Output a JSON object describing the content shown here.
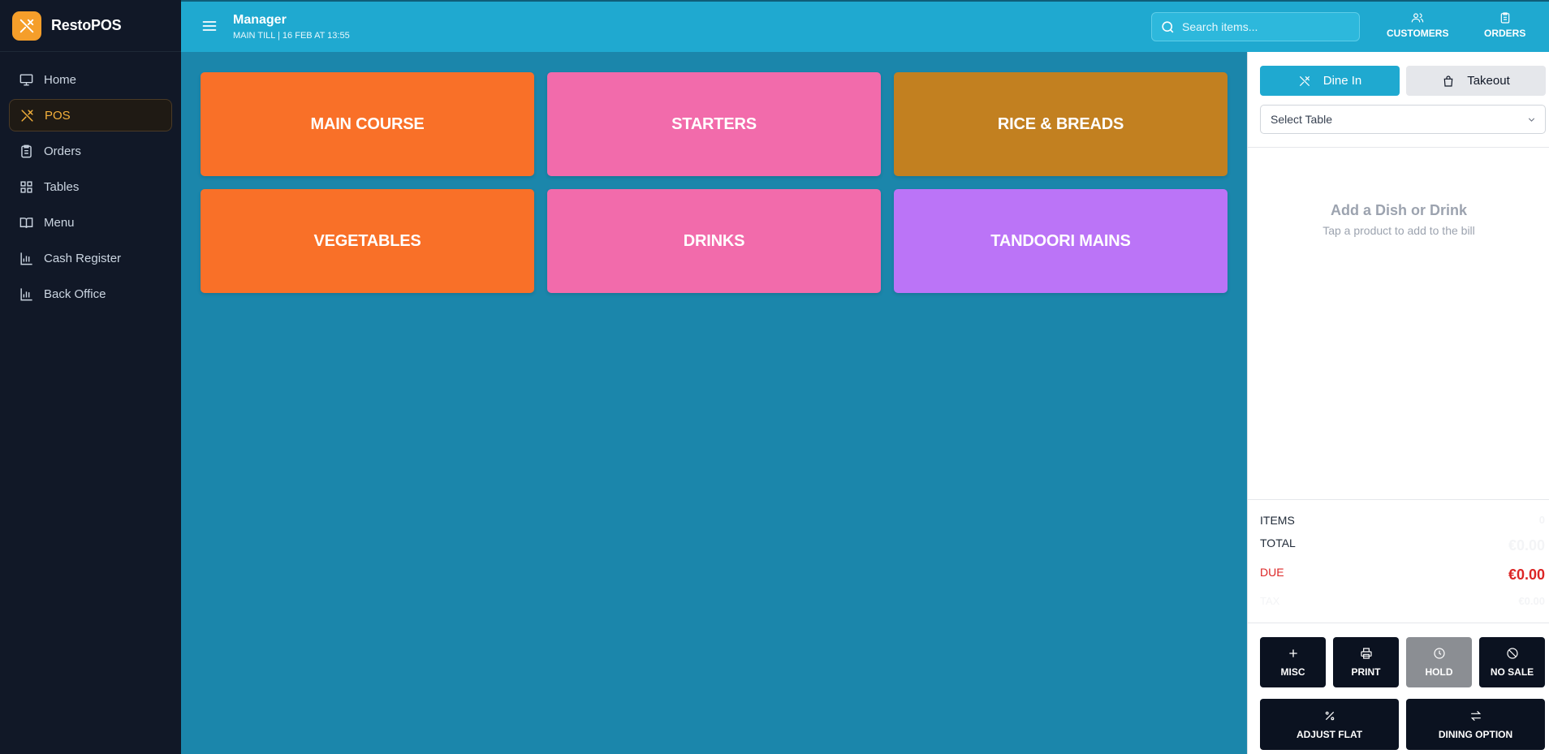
{
  "app": {
    "name": "RestoPOS"
  },
  "sidebar": {
    "items": [
      {
        "label": "Home",
        "icon": "monitor-icon",
        "active": false
      },
      {
        "label": "POS",
        "icon": "utensils-icon",
        "active": true
      },
      {
        "label": "Orders",
        "icon": "clipboard-icon",
        "active": false
      },
      {
        "label": "Tables",
        "icon": "grid-icon",
        "active": false
      },
      {
        "label": "Menu",
        "icon": "book-icon",
        "active": false
      },
      {
        "label": "Cash Register",
        "icon": "bar-chart-icon",
        "active": false
      },
      {
        "label": "Back Office",
        "icon": "bar-chart-icon",
        "active": false
      }
    ]
  },
  "header": {
    "title": "Manager",
    "subtitle": "MAIN TILL | 16 FEB AT 13:55",
    "search_placeholder": "Search items...",
    "customers_label": "CUSTOMERS",
    "orders_label": "ORDERS"
  },
  "categories": [
    {
      "label": "MAIN COURSE",
      "color": "#f97028"
    },
    {
      "label": "STARTERS",
      "color": "#f26bab"
    },
    {
      "label": "RICE & BREADS",
      "color": "#c28020"
    },
    {
      "label": "VEGETABLES",
      "color": "#f97028"
    },
    {
      "label": "DRINKS",
      "color": "#f26bab"
    },
    {
      "label": "TANDOORI MAINS",
      "color": "#bb74f7"
    }
  ],
  "order_panel": {
    "dine_in_label": "Dine In",
    "takeout_label": "Takeout",
    "select_table_placeholder": "Select Table",
    "empty_title": "Add a Dish or Drink",
    "empty_subtitle": "Tap a product to add to the bill",
    "summary": {
      "items_label": "ITEMS",
      "items_value": "0",
      "total_label": "TOTAL",
      "total_value": "€0.00",
      "due_label": "DUE",
      "due_value": "€0.00",
      "tax_label": "TAX",
      "tax_value": "€0.00"
    },
    "actions": {
      "misc": "MISC",
      "print": "PRINT",
      "hold": "HOLD",
      "no_sale": "NO SALE",
      "adjust_flat": "ADJUST FLAT",
      "dining_option": "DINING OPTION"
    }
  },
  "colors": {
    "accent": "#1fa9d0",
    "background": "#1b86ab",
    "sidebar": "#111827",
    "due": "#dc2626",
    "active_nav": "#f5b13b"
  }
}
